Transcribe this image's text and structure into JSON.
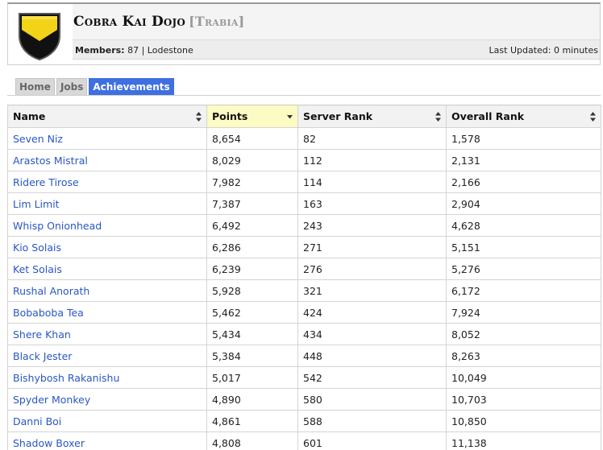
{
  "header": {
    "ls_name": "Cobra Kai Dojo",
    "server": "[Trabia]",
    "members_label": "Members:",
    "members_count": "87",
    "separator": "|",
    "world": "Lodestone",
    "last_updated": "Last Updated: 0 minutes"
  },
  "tabs": [
    {
      "label": "Home",
      "active": false
    },
    {
      "label": "Jobs",
      "active": false
    },
    {
      "label": "Achievements",
      "active": true
    }
  ],
  "table": {
    "columns": [
      "Name",
      "Points",
      "Server Rank",
      "Overall Rank"
    ],
    "sorted_column": "Points",
    "rows": [
      {
        "name": "Seven Niz",
        "points": "8,654",
        "server_rank": "82",
        "overall_rank": "1,578"
      },
      {
        "name": "Arastos Mistral",
        "points": "8,029",
        "server_rank": "112",
        "overall_rank": "2,131"
      },
      {
        "name": "Ridere Tirose",
        "points": "7,982",
        "server_rank": "114",
        "overall_rank": "2,166"
      },
      {
        "name": "Lim Limit",
        "points": "7,387",
        "server_rank": "163",
        "overall_rank": "2,904"
      },
      {
        "name": "Whisp Onionhead",
        "points": "6,492",
        "server_rank": "243",
        "overall_rank": "4,628"
      },
      {
        "name": "Kio Solais",
        "points": "6,286",
        "server_rank": "271",
        "overall_rank": "5,151"
      },
      {
        "name": "Ket Solais",
        "points": "6,239",
        "server_rank": "276",
        "overall_rank": "5,276"
      },
      {
        "name": "Rushal Anorath",
        "points": "5,928",
        "server_rank": "321",
        "overall_rank": "6,172"
      },
      {
        "name": "Bobaboba Tea",
        "points": "5,462",
        "server_rank": "424",
        "overall_rank": "7,924"
      },
      {
        "name": "Shere Khan",
        "points": "5,434",
        "server_rank": "434",
        "overall_rank": "8,052"
      },
      {
        "name": "Black Jester",
        "points": "5,384",
        "server_rank": "448",
        "overall_rank": "8,263"
      },
      {
        "name": "Bishybosh Rakanishu",
        "points": "5,017",
        "server_rank": "542",
        "overall_rank": "10,049"
      },
      {
        "name": "Spyder Monkey",
        "points": "4,890",
        "server_rank": "580",
        "overall_rank": "10,703"
      },
      {
        "name": "Danni Boi",
        "points": "4,861",
        "server_rank": "588",
        "overall_rank": "10,850"
      },
      {
        "name": "Shadow Boxer",
        "points": "4,808",
        "server_rank": "601",
        "overall_rank": "11,138"
      }
    ]
  },
  "colors": {
    "link": "#2a56c6",
    "active_tab": "#3f6fe0",
    "sorted_header": "#fdfbc4",
    "crest_yellow": "#f2d318",
    "crest_black": "#111111"
  },
  "icons": {
    "crest": "linkshell-crest-icon",
    "sort": "sort-arrows-icon",
    "sort_desc": "sort-desc-icon"
  }
}
